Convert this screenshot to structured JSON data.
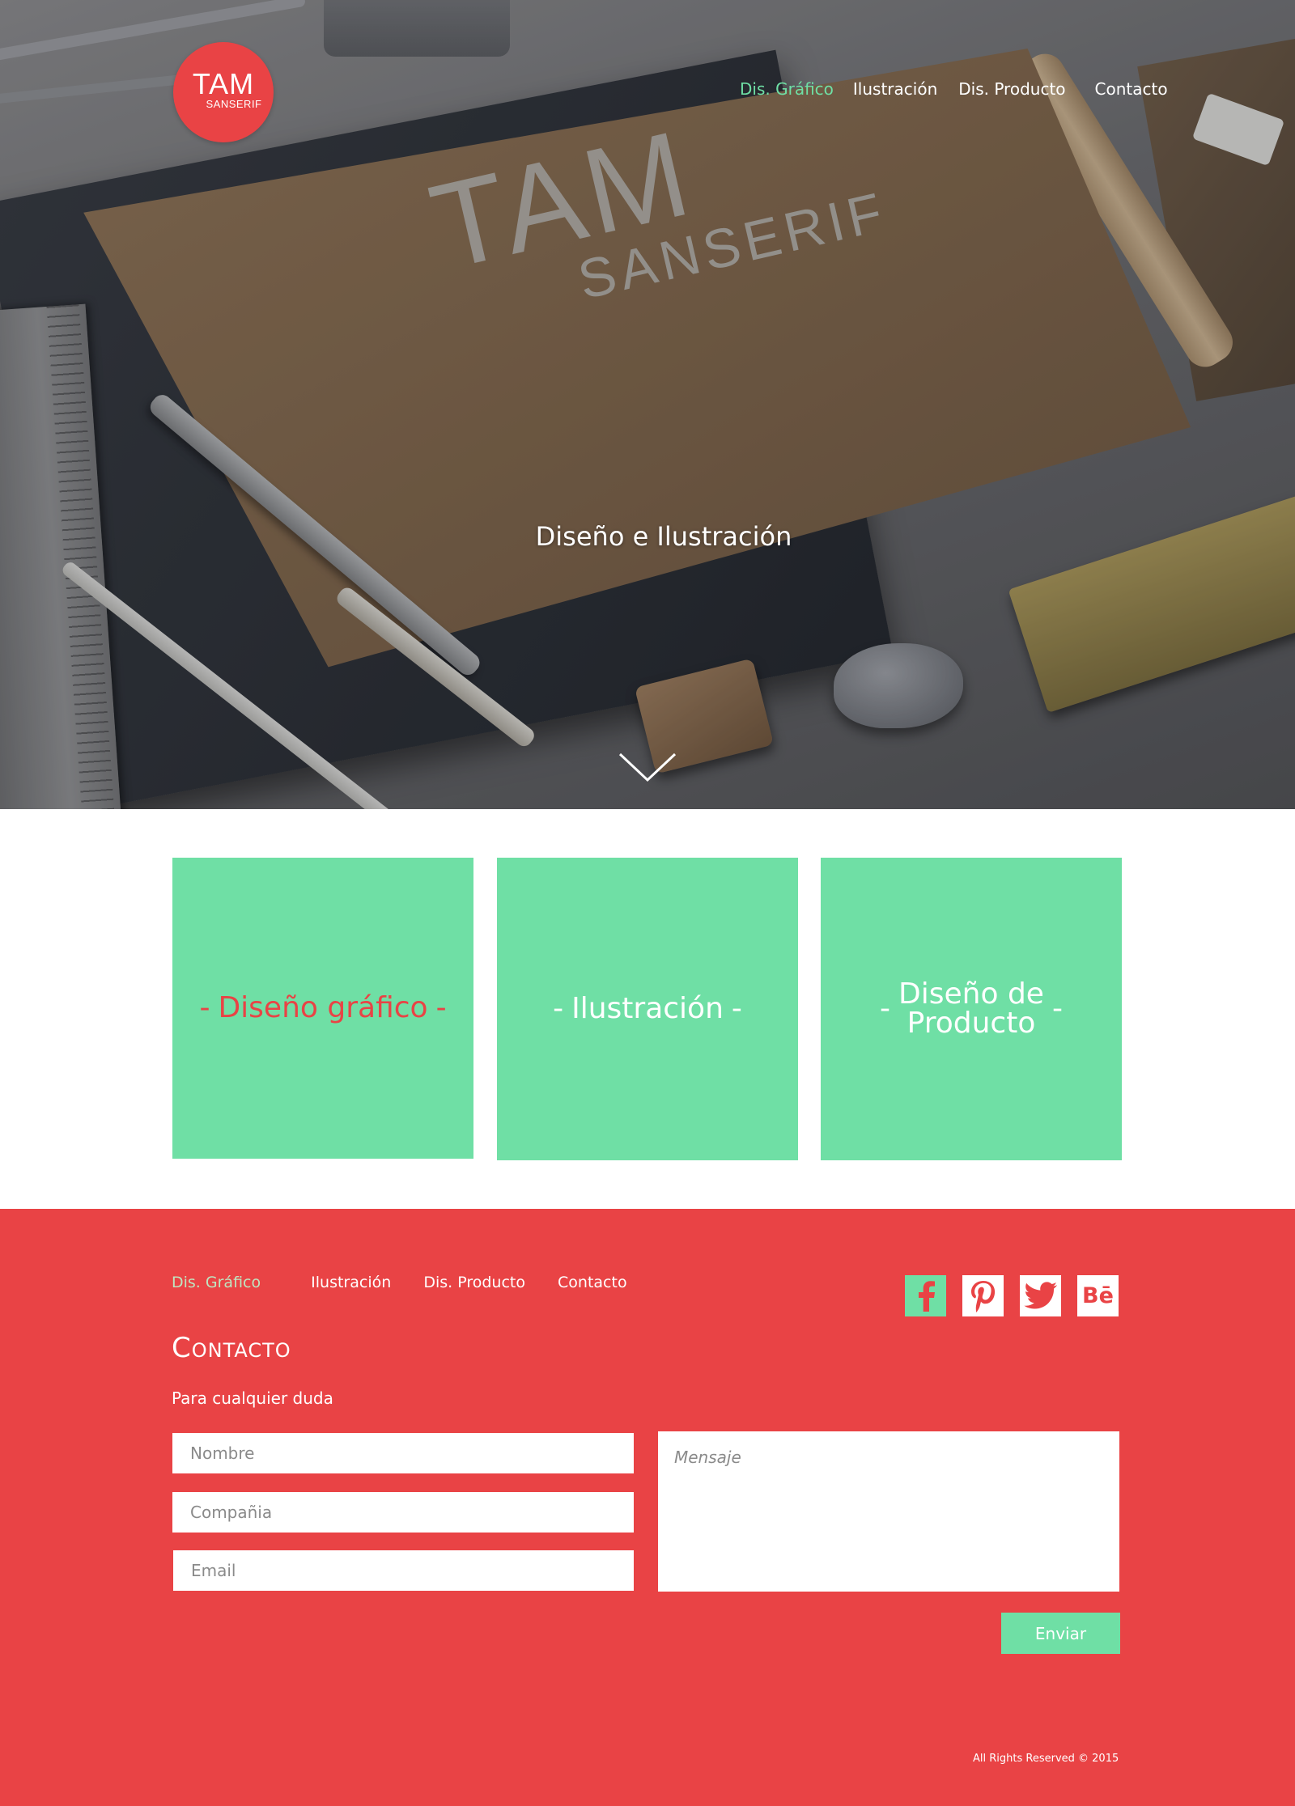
{
  "brand": {
    "logo_main": "TAM",
    "logo_sub": "SANSERIF",
    "sheet_title": "TAM",
    "sheet_subtitle": "SANSERIF"
  },
  "nav": {
    "items": [
      {
        "label": "Dis. Gráfico",
        "active": true
      },
      {
        "label": "Ilustración",
        "active": false
      },
      {
        "label": "Dis. Producto",
        "active": false
      },
      {
        "label": "Contacto",
        "active": false
      }
    ]
  },
  "hero": {
    "tagline": "Diseño e Ilustración",
    "scroll_icon": "chevron-down-icon"
  },
  "categories": [
    {
      "label": "Diseño gráfico",
      "dash": "-"
    },
    {
      "label": "Ilustración",
      "dash": "-"
    },
    {
      "label_line1": "Diseño de",
      "label_line2": "Producto",
      "dash": "-"
    }
  ],
  "footer": {
    "nav": [
      {
        "label": "Dis. Gráfico",
        "active": true
      },
      {
        "label": "Ilustración",
        "active": false
      },
      {
        "label": "Dis. Producto",
        "active": false
      },
      {
        "label": "Contacto",
        "active": false
      }
    ],
    "social": [
      {
        "icon": "facebook-icon"
      },
      {
        "icon": "pinterest-icon"
      },
      {
        "icon": "twitter-icon"
      },
      {
        "icon": "behance-icon",
        "text": "Bē"
      }
    ],
    "contact_title": "Contacto",
    "contact_subtitle": "Para cualquier duda",
    "form": {
      "name_placeholder": "Nombre",
      "company_placeholder": "Compañia",
      "email_placeholder": "Email",
      "message_placeholder": "Mensaje",
      "send_label": "Enviar"
    },
    "rights": "All Rights Reserved © 2015"
  },
  "colors": {
    "accent_red": "#e94345",
    "accent_green": "#6fdfa5",
    "white": "#ffffff"
  }
}
